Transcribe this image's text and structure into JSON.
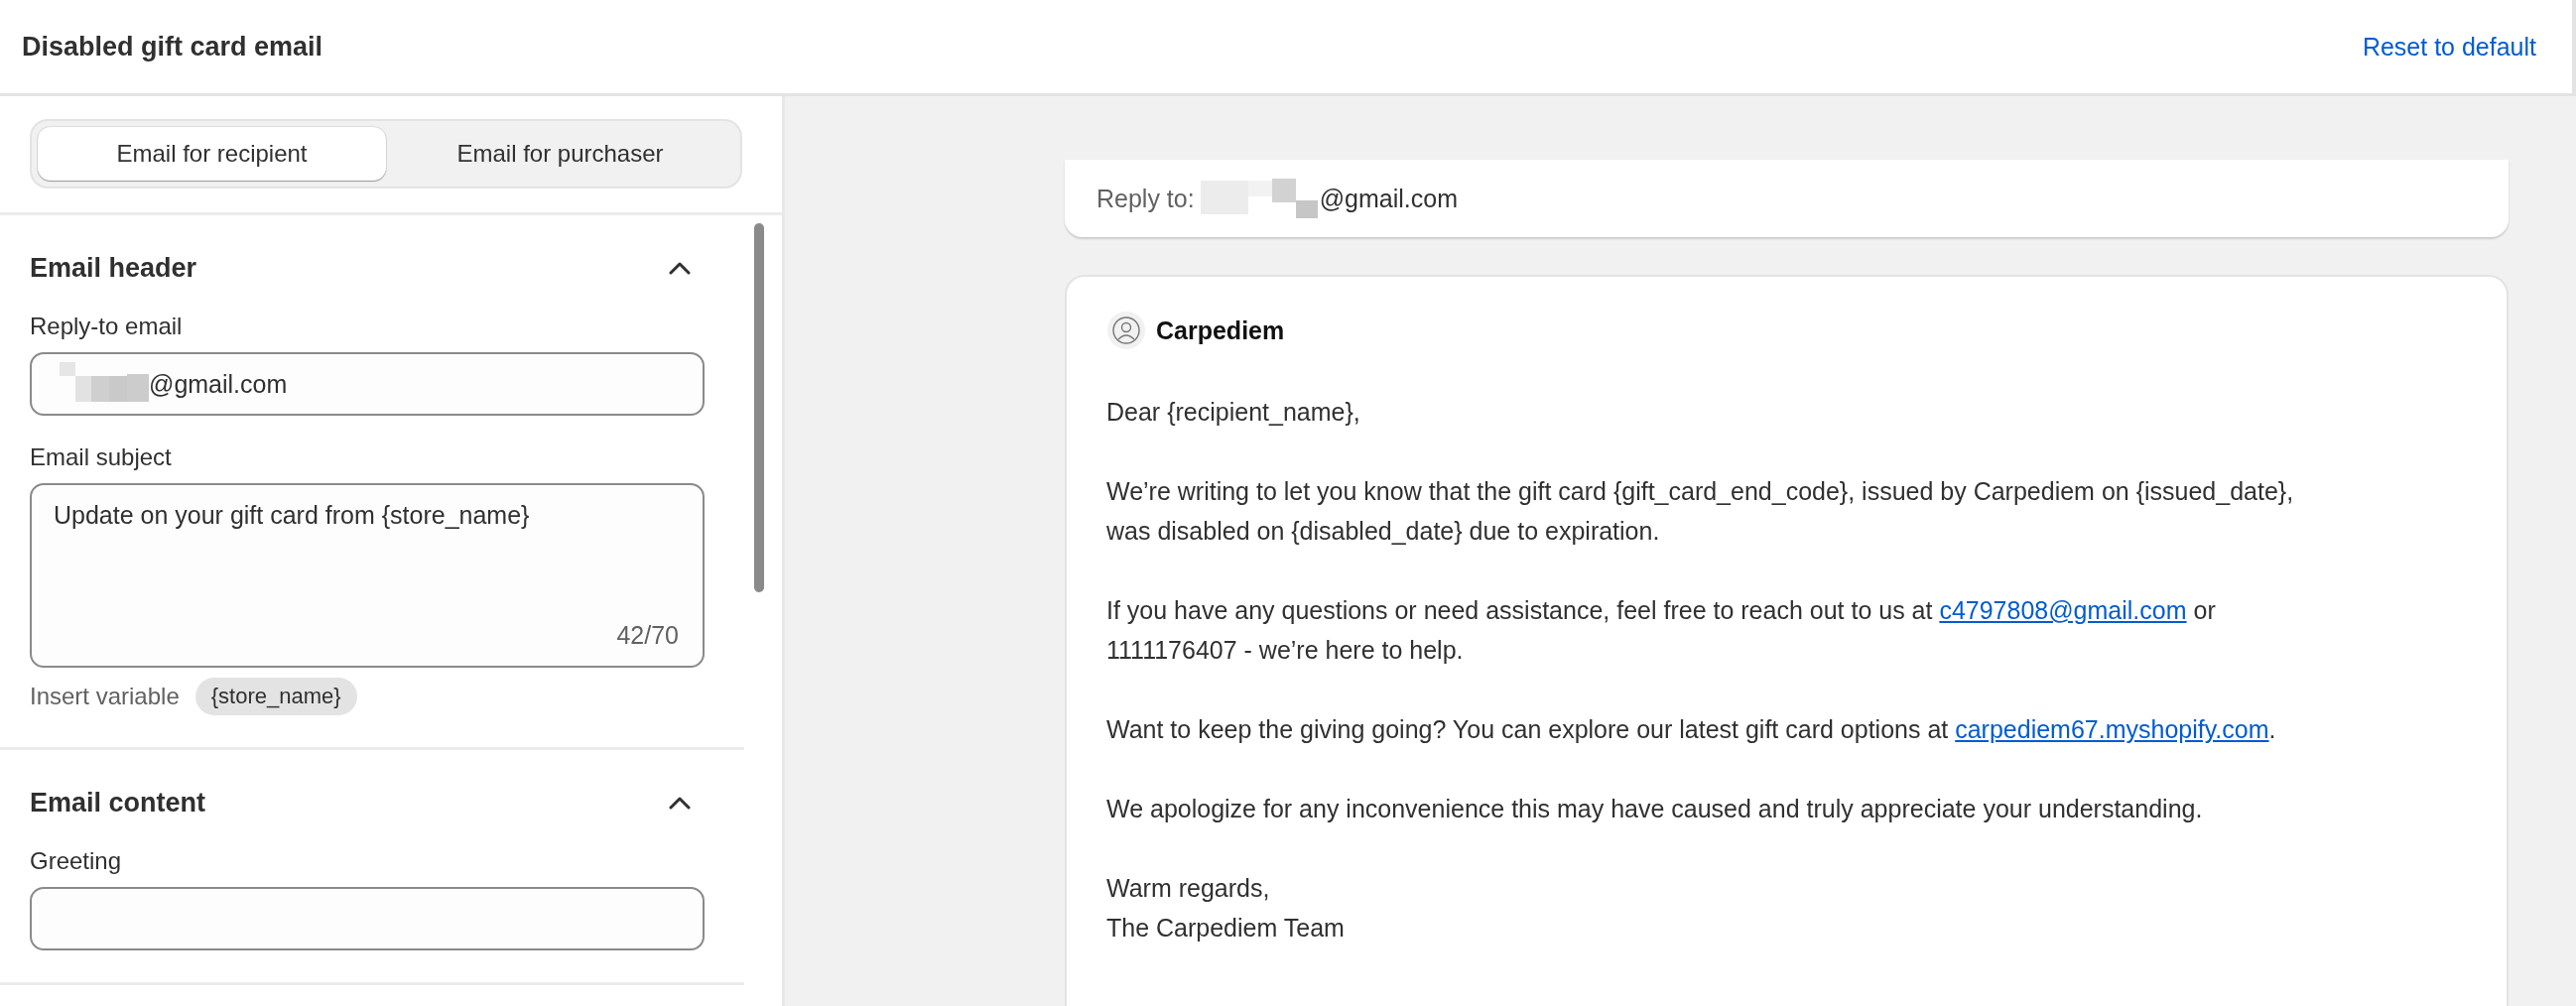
{
  "header": {
    "title": "Disabled gift card email",
    "reset_link": "Reset to default"
  },
  "tabs": [
    {
      "label": "Email for recipient",
      "selected": true
    },
    {
      "label": "Email for purchaser",
      "selected": false
    }
  ],
  "sections": [
    {
      "title": "Email header",
      "expanded": true,
      "fields": [
        {
          "kind": "input",
          "label": "Reply-to email",
          "value": "@gmail.com",
          "redacted": true
        },
        {
          "kind": "textarea",
          "label": "Email subject",
          "value": "Update on your gift card from {store_name}",
          "counter": "42/70",
          "insert_label": "Insert variable",
          "variables": [
            "{store_name}"
          ]
        }
      ]
    },
    {
      "title": "Email content",
      "expanded": true,
      "fields": [
        {
          "kind": "input",
          "label": "Greeting",
          "redacted": false
        }
      ]
    }
  ],
  "preview": {
    "reply_to_label": "Reply to:",
    "reply_to_value": "@gmail.com",
    "redacted": true,
    "sender": "Carpediem",
    "paragraphs": [
      {
        "lines": [
          [
            {
              "kind": "text",
              "text": "Dear {recipient_name},"
            }
          ]
        ]
      },
      {
        "lines": [
          [
            {
              "kind": "text",
              "text": "We’re writing to let you know that the gift card {gift_card_end_code}, issued by Carpediem on {issued_date},"
            }
          ],
          [
            {
              "kind": "text",
              "text": "was disabled on {disabled_date} due to expiration."
            }
          ]
        ]
      },
      {
        "lines": [
          [
            {
              "kind": "text",
              "text": "If you have any questions or need assistance, feel free to reach out to us at "
            },
            {
              "kind": "link",
              "text": "c4797808@gmail.com"
            },
            {
              "kind": "text",
              "text": " or"
            }
          ],
          [
            {
              "kind": "text",
              "text": "1111176407 - we’re here to help."
            }
          ]
        ]
      },
      {
        "lines": [
          [
            {
              "kind": "text",
              "text": "Want to keep the giving going? You can explore our latest gift card options at "
            },
            {
              "kind": "link",
              "text": "carpediem67.myshopify.com"
            },
            {
              "kind": "text",
              "text": "."
            }
          ]
        ]
      },
      {
        "lines": [
          [
            {
              "kind": "text",
              "text": "We apologize for any inconvenience this may have caused and truly appreciate your understanding."
            }
          ]
        ]
      },
      {
        "lines": [
          [
            {
              "kind": "text",
              "text": "Warm regards,"
            }
          ],
          [
            {
              "kind": "text",
              "text": "The Carpediem Team"
            }
          ]
        ]
      }
    ]
  }
}
